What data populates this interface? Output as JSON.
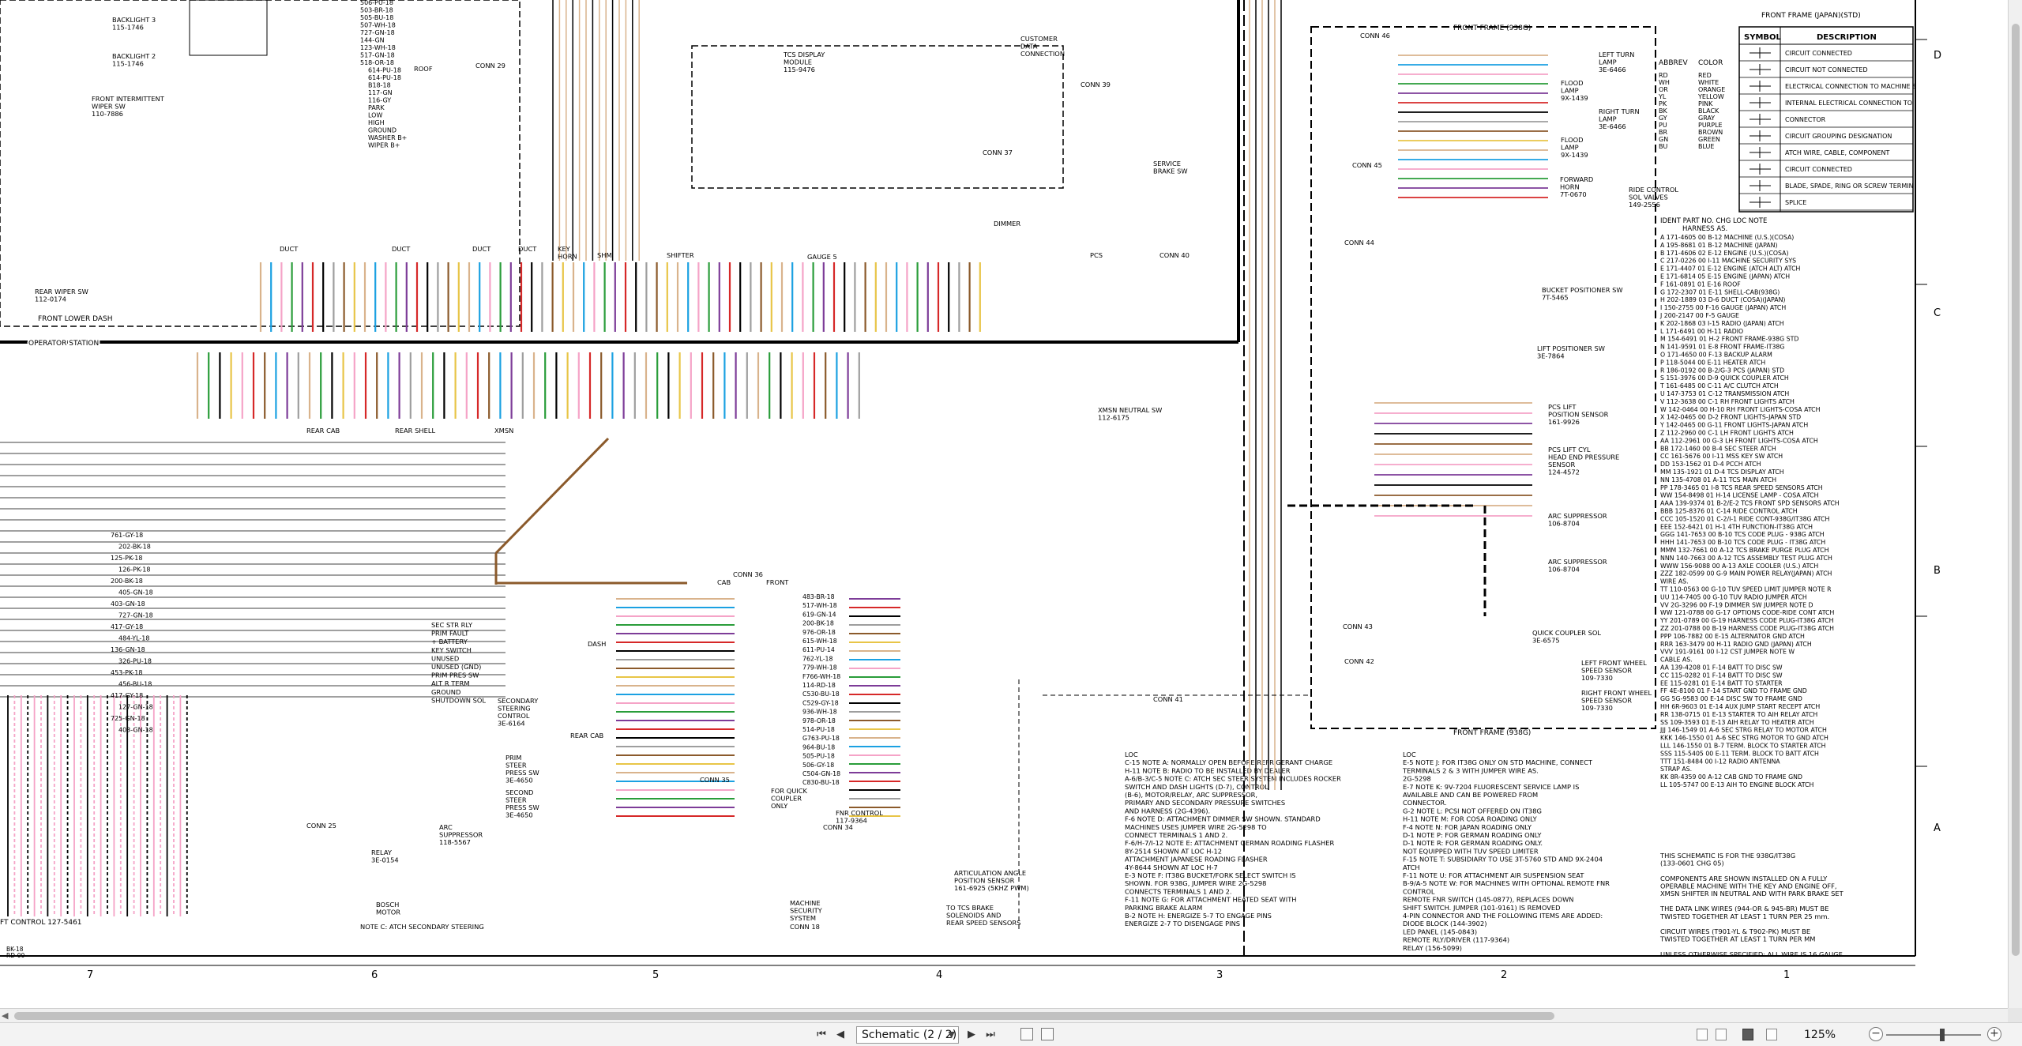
{
  "page_selector": {
    "value": "Schematic (2 / 2)"
  },
  "zoom": {
    "value": "125%"
  },
  "frame": {
    "front_frame_sto": "FRONT FRAME (JAPAN)(STD)",
    "front_frame_938g": "FRONT FRAME (938G)",
    "front_frame_938g_bottom": "FRONT FRAME (938G)",
    "operator_station": "OPERATOR STATION",
    "front_lower_dash": "FRONT LOWER DASH",
    "col_numbers": [
      "7",
      "6",
      "5",
      "4",
      "3",
      "2",
      "1"
    ],
    "row_letters": [
      "D",
      "C",
      "B",
      "A"
    ]
  },
  "symbol_table": {
    "headers": [
      "SYMBOL",
      "DESCRIPTION"
    ],
    "rows": [
      "CIRCUIT CONNECTED",
      "CIRCUIT NOT CONNECTED",
      "ELECTRICAL CONNECTION TO MACHINE STRUCTURE",
      "INTERNAL ELECTRICAL CONNECTION TO SURFACE OF COMPONENT",
      "CONNECTOR",
      "CIRCUIT GROUPING DESIGNATION",
      "ATCH WIRE, CABLE, COMPONENT",
      "CIRCUIT CONNECTED",
      "BLADE, SPADE, RING OR SCREW TERMINAL",
      "SPLICE"
    ]
  },
  "color_table": {
    "headers": [
      "ABBREV",
      "COLOR"
    ],
    "rows": [
      [
        "RD",
        "RED"
      ],
      [
        "WH",
        "WHITE"
      ],
      [
        "OR",
        "ORANGE"
      ],
      [
        "YL",
        "YELLOW"
      ],
      [
        "PK",
        "PINK"
      ],
      [
        "BK",
        "BLACK"
      ],
      [
        "GY",
        "GRAY"
      ],
      [
        "PU",
        "PURPLE"
      ],
      [
        "BR",
        "BROWN"
      ],
      [
        "GN",
        "GREEN"
      ],
      [
        "BU",
        "BLUE"
      ]
    ]
  },
  "harness_table": {
    "header": "IDENT  PART NO.  CHG LOC      NOTE",
    "subheader": "HARNESS AS.",
    "rows": [
      "A    171-4605  00  B-12  MACHINE (U.S.)(COSA)",
      "A    195-8681  01  B-12  MACHINE (JAPAN)",
      "B    171-4606  02  E-12  ENGINE (U.S.)(COSA)",
      "C    217-0226  00  I-11  MACHINE SECURITY SYS",
      "E    171-4407  01  E-12  ENGINE (ATCH ALT)         ATCH",
      "E    171-6814  05  E-15  ENGINE (JAPAN)            ATCH",
      "F    161-0891  01  E-16  ROOF",
      "G    172-2307  01  E-11  SHELL-CAB(938G)",
      "H    202-1889  03  D-6   DUCT (COSA)(JAPAN)",
      "I    150-2755  00  F-16  GAUGE (JAPAN)             ATCH",
      "J    200-2147  00  F-5   GAUGE",
      "K    202-1868  03  I-15  RADIO (JAPAN)             ATCH",
      "L    171-6491  00  H-11  RADIO",
      "M    154-6491  01  H-2   FRONT FRAME-938G          STD",
      "N    141-9591  01  E-8   FRONT FRAME-IT38G",
      "O    171-4650  00  F-13  BACKUP ALARM",
      "P    118-5044  00  E-11  HEATER                    ATCH",
      "R    186-0192  00  B-2/G-3  PCS (JAPAN)            STD",
      "S    151-3976  00  D-9   QUICK COUPLER             ATCH",
      "T    161-6485  00  C-11  A/C CLUTCH                ATCH",
      "U    147-3753  01  C-12  TRANSMISSION              ATCH",
      "V    112-3638  00  C-1   RH FRONT LIGHTS           ATCH",
      "W    142-0464  00  H-10  RH FRONT LIGHTS-COSA      ATCH",
      "X    142-0465  00  D-2   FRONT LIGHTS-JAPAN        STD",
      "Y    142-0465  00  G-11  FRONT LIGHTS-JAPAN        ATCH",
      "Z    112-2960  00  C-1   LH FRONT LIGHTS           ATCH",
      "AA   112-2961  00  G-3   LH FRONT LIGHTS-COSA      ATCH",
      "BB   172-1460  00  B-4   SEC STEER                 ATCH",
      "CC   161-5676  00  I-11  MSS KEY SW                ATCH",
      "DD   153-1562  01  D-4   PCCH                      ATCH",
      "MM   135-1921  01  D-4   TCS DISPLAY               ATCH",
      "NN   135-4708  01  A-11  TCS MAIN                  ATCH",
      "PP   178-3465  01  I-8   TCS REAR SPEED SENSORS    ATCH",
      "WW   154-8498  01  H-14  LICENSE LAMP - COSA       ATCH",
      "AAA  139-9374  01  B-2/E-2  TCS FRONT SPD SENSORS  ATCH",
      "BBB  125-8376  01  C-14  RIDE CONTROL              ATCH",
      "CCC  105-1520  01  C-2/I-1  RIDE CONT-938G/IT38G   ATCH",
      "EEE  152-6421  01  H-1   4TH FUNCTION-IT38G        ATCH",
      "GGG  141-7653  00  B-10  TCS CODE PLUG - 938G      ATCH",
      "HHH  141-7653  00  B-10  TCS CODE PLUG - IT38G     ATCH",
      "MMM  132-7661  00  A-12  TCS BRAKE PURGE PLUG      ATCH",
      "NNN  140-7663  00  A-12  TCS ASSEMBLY TEST PLUG    ATCH",
      "WWW  156-9088  00  A-13  AXLE COOLER (U.S.)        ATCH",
      "ZZZ  182-0599  00  G-9   MAIN POWER RELAY(JAPAN)   ATCH",
      "WIRE AS.",
      "TT   110-0563  00  G-10  TUV SPEED LIMIT JUMPER    NOTE R",
      "UU   114-7405  00  G-10  TUV RADIO JUMPER          ATCH",
      "VV   2G-3296   00  F-19  DIMMER SW JUMPER          NOTE D",
      "WW   121-0788  00  G-17  OPTIONS CODE-RIDE CONT    ATCH",
      "YY   201-0789  00  G-19  HARNESS CODE PLUG-IT38G   ATCH",
      "ZZ   201-0788  00  B-19  HARNESS CODE PLUG-IT38G   ATCH",
      "PPP  106-7882  00  E-15  ALTERNATOR GND            ATCH",
      "RRR  163-3479  00  H-11  RADIO GND (JAPAN)         ATCH",
      "VVV  191-9161  00  I-12  CST JUMPER                NOTE W",
      "CABLE AS.",
      "AA   139-4208  01  F-14  BATT TO DISC SW",
      "CC   115-0282  01  F-14  BATT TO DISC SW",
      "EE   115-0281  01  E-14  BATT TO STARTER",
      "FF   4E-8100   01  F-14  START GND TO FRAME GND",
      "GG   5G-9583   00  E-14  DISC SW TO FRAME GND",
      "HH   6R-9603   01  E-14  AUX JUMP START RECEPT     ATCH",
      "RR   138-0715  01  E-13  STARTER TO AIH RELAY      ATCH",
      "SS   109-3593  01  E-13  AIH RELAY TO HEATER       ATCH",
      "JJJ  146-1549  01  A-6   SEC STRG RELAY TO MOTOR   ATCH",
      "KKK  146-1550  01  A-6   SEC STRG MOTOR TO GND     ATCH",
      "LLL  146-1550  01  B-7   TERM. BLOCK TO STARTER    ATCH",
      "SSS  115-5405  00  E-11  TERM. BLOCK TO BATT       ATCH",
      "TTT  151-8484  00  I-12  RADIO ANTENNA",
      "STRAP AS.",
      "KK   8R-4359   00  A-12  CAB GND TO FRAME GND",
      "LL   105-5747  00  E-13  AIH TO ENGINE BLOCK       ATCH"
    ]
  },
  "notes_left": [
    "LOC",
    "C-15   NOTE A: NORMALLY OPEN BEFORE REFRIGERANT CHARGE",
    "H-11   NOTE B: RADIO TO BE INSTALLED BY DEALER",
    "A-6/B-3/C-5  NOTE C: ATCH SEC STEER SYSTEM INCLUDES ROCKER",
    "       SWITCH AND DASH LIGHTS (D-7), CONTROL",
    "       (B-6), MOTOR/RELAY, ARC SUPPRESSOR,",
    "       PRIMARY AND SECONDARY PRESSURE SWITCHES",
    "       AND HARNESS (2G-4396).",
    "F-6    NOTE D: ATTACHMENT DIMMER SW SHOWN. STANDARD",
    "       MACHINES USES JUMPER WIRE 2G-5298 TO",
    "       CONNECT TERMINALS 1 AND 2.",
    "F-6/H-7/I-12  NOTE E: ATTACHMENT GERMAN ROADING FLASHER",
    "       8Y-2514 SHOWN AT LOC H-12",
    "       ATTACHMENT JAPANESE ROADING FLASHER",
    "       4Y-8644 SHOWN AT LOC H-7",
    "E-3    NOTE F: IT38G BUCKET/FORK SELECT SWITCH IS",
    "       SHOWN. FOR 938G, JUMPER WIRE 2G-5298",
    "       CONNECTS TERMINALS 1 AND 2.",
    "F-11   NOTE G: FOR ATTACHMENT HEATED SEAT WITH",
    "       PARKING BRAKE ALARM",
    "B-2    NOTE H: ENERGIZE 5-7 TO ENGAGE PINS",
    "       ENERGIZE 2-7 TO DISENGAGE PINS"
  ],
  "notes_right": [
    "LOC",
    "E-5    NOTE J: FOR IT38G ONLY ON STD MACHINE, CONNECT",
    "       TERMINALS 2 & 3 WITH JUMPER WIRE AS.",
    "       2G-5298",
    "E-7    NOTE K: 9V-7204 FLUORESCENT SERVICE LAMP IS",
    "       AVAILABLE AND CAN BE POWERED FROM",
    "       CONNECTOR.",
    "G-2    NOTE L: PCSI NOT OFFERED ON IT38G",
    "H-11   NOTE M: FOR COSA ROADING ONLY",
    "F-4    NOTE N: FOR JAPAN ROADING ONLY",
    "D-1    NOTE P: FOR GERMAN ROADING ONLY",
    "D-1    NOTE R: FOR GERMAN ROADING ONLY.",
    "       NOT EQUIPPED WITH TUV SPEED LIMITER",
    "F-15   NOTE T: SUBSIDIARY TO USE 3T-5760 STD AND 9X-2404",
    "       ATCH",
    "F-11   NOTE U: FOR ATTACHMENT AIR SUSPENSION SEAT",
    "B-9/A-5  NOTE W: FOR MACHINES WITH OPTIONAL REMOTE FNR",
    "       CONTROL",
    "       REMOTE FNR SWITCH (145-0877), REPLACES DOWN",
    "       SHIFT SWITCH. JUMPER (101-9161) IS REMOVED",
    "       4-PIN CONNECTOR AND THE FOLLOWING ITEMS ARE ADDED:",
    "       DIODE BLOCK (144-3902)",
    "       LED PANEL (145-0843)",
    "       REMOTE RLY/DRIVER (117-9364)",
    "       RELAY (156-5099)"
  ],
  "footnotes": [
    "THIS SCHEMATIC IS FOR THE 938G/IT38G",
    "(133-0601 CHG 05)",
    "",
    "COMPONENTS ARE SHOWN INSTALLED ON A FULLY",
    "OPERABLE MACHINE WITH THE KEY AND ENGINE OFF,",
    "XMSN SHIFTER IN NEUTRAL AND WITH PARK BRAKE SET",
    "",
    "THE DATA LINK WIRES (944-OR & 945-BR) MUST BE",
    "TWISTED TOGETHER AT LEAST 1 TURN PER 25 mm.",
    "",
    "CIRCUIT WIRES (T901-YL & T902-PK) MUST BE",
    "TWISTED TOGETHER AT LEAST 1 TURN PER MM",
    "",
    "UNLESS OTHERWISE SPECIFIED: ALL WIRE IS 16 GAUGE"
  ],
  "components": [
    {
      "id": "backlight3",
      "label": "BACKLIGHT 3\n115-1746"
    },
    {
      "id": "backlight2",
      "label": "BACKLIGHT 2\n115-1746"
    },
    {
      "id": "front-int-wiper",
      "label": "FRONT INTERMITTENT\nWIPER SW\n110-7886"
    },
    {
      "id": "rear-wiper",
      "label": "REAR WIPER SW\n112-0174"
    },
    {
      "id": "tcs-display",
      "label": "TCS DISPLAY\nMODULE\n115-9476"
    },
    {
      "id": "customer-data",
      "label": "CUSTOMER\nDATA\nCONNECTION"
    },
    {
      "id": "service-brake",
      "label": "SERVICE\nBRAKE SW"
    },
    {
      "id": "forward-horn",
      "label": "FORWARD\nHORN\n7T-0670"
    },
    {
      "id": "ride-control",
      "label": "RIDE CONTROL\nSOL VALVES\n149-2556"
    },
    {
      "id": "flood-lamp-1",
      "label": "FLOOD\nLAMP\n9X-1439"
    },
    {
      "id": "flood-lamp-2",
      "label": "FLOOD\nLAMP\n9X-1439"
    },
    {
      "id": "left-turn",
      "label": "LEFT TURN\nLAMP\n3E-6466"
    },
    {
      "id": "right-turn",
      "label": "RIGHT TURN\nLAMP\n3E-6466"
    },
    {
      "id": "bucket-positioner",
      "label": "BUCKET POSITIONER SW\n7T-5465"
    },
    {
      "id": "lift-positioner",
      "label": "LIFT POSITIONER SW\n3E-7864"
    },
    {
      "id": "pcs-lift",
      "label": "PCS LIFT\nPOSITION SENSOR\n161-9926"
    },
    {
      "id": "pcs-lift-cyl",
      "label": "PCS LIFT CYL\nHEAD END PRESSURE\nSENSOR\n124-4572"
    },
    {
      "id": "arc-sup-1",
      "label": "ARC SUPPRESSOR\n106-8704"
    },
    {
      "id": "arc-sup-2",
      "label": "ARC SUPPRESSOR\n106-8704"
    },
    {
      "id": "quick-coupler-sol",
      "label": "QUICK COUPLER SOL\n3E-6575"
    },
    {
      "id": "left-front-wheel",
      "label": "LEFT FRONT WHEEL\nSPEED SENSOR\n109-7330"
    },
    {
      "id": "right-front-wheel",
      "label": "RIGHT FRONT WHEEL\nSPEED SENSOR\n109-7330"
    },
    {
      "id": "xmsn-neutral",
      "label": "XMSN NEUTRAL SW\n112-6175"
    },
    {
      "id": "sec-steering",
      "label": "SECONDARY\nSTEERING\nCONTROL\n3E-6164"
    },
    {
      "id": "prim-steer",
      "label": "PRIM\nSTEER\nPRESS SW\n3E-4650"
    },
    {
      "id": "second-steer",
      "label": "SECOND\nSTEER\nPRESS SW\n3E-4650"
    },
    {
      "id": "relay",
      "label": "RELAY\n3E-0154"
    },
    {
      "id": "arc-suppressor-s",
      "label": "ARC\nSUPPRESSOR\n118-5567"
    },
    {
      "id": "bosch-motor",
      "label": "BOSCH\nMOTOR"
    },
    {
      "id": "machine-security",
      "label": "MACHINE\nSECURITY\nSYSTEM"
    },
    {
      "id": "fnr-control",
      "label": "FNR CONTROL\n117-9364"
    },
    {
      "id": "quick-coupler-only",
      "label": "FOR QUICK\nCOUPLER\nONLY"
    },
    {
      "id": "articulation",
      "label": "ARTICULATION ANGLE\nPOSITION SENSOR\n161-6925 (5KHZ PWM)"
    },
    {
      "id": "tcs-brake",
      "label": "TO TCS BRAKE\nSOLENOIDS AND\nREAR SPEED SENSORS"
    },
    {
      "id": "note-c",
      "label": "NOTE C: ATCH SECONDARY STEERING"
    },
    {
      "id": "rear-shell",
      "label": "REAR SHELL"
    },
    {
      "id": "rear-cab",
      "label": "REAR CAB"
    },
    {
      "id": "xmsn",
      "label": "XMSN"
    },
    {
      "id": "shifter",
      "label": "SHIFTER"
    },
    {
      "id": "key-horn",
      "label": "KEY\nHORN"
    },
    {
      "id": "pcs",
      "label": "PCS"
    },
    {
      "id": "dimmer",
      "label": "DIMMER"
    },
    {
      "id": "gauge",
      "label": "GAUGE 5"
    },
    {
      "id": "conn29",
      "label": "CONN 29"
    },
    {
      "id": "conn36",
      "label": "CONN 36"
    },
    {
      "id": "conn39",
      "label": "CONN 39"
    },
    {
      "id": "conn40",
      "label": "CONN 40"
    },
    {
      "id": "conn41",
      "label": "CONN 41"
    },
    {
      "id": "conn42",
      "label": "CONN 42"
    },
    {
      "id": "conn43",
      "label": "CONN 43"
    },
    {
      "id": "conn44",
      "label": "CONN 44"
    },
    {
      "id": "conn45",
      "label": "CONN 45"
    },
    {
      "id": "conn46",
      "label": "CONN 46"
    },
    {
      "id": "conn34",
      "label": "CONN 34"
    },
    {
      "id": "conn35",
      "label": "CONN 35"
    },
    {
      "id": "conn37",
      "label": "CONN 37"
    },
    {
      "id": "conn18",
      "label": "CONN 18"
    },
    {
      "id": "conn25",
      "label": "CONN 25"
    }
  ],
  "wire_labels_left": [
    "506-PU-18",
    "503-BR-18",
    "505-BU-18",
    "507-WH-18",
    "727-GN-18",
    "144-GN",
    "123-WH-18",
    "517-GN-18",
    "518-OR-18",
    "614-PU-18",
    "614-PU-18",
    "B18-18",
    "117-GN",
    "116-GY",
    "PARK",
    "LOW",
    "HIGH",
    "GROUND",
    "WASHER B+",
    "WIPER B+"
  ],
  "wire_labels_lower": [
    "761-GY-18",
    "202-BK-18",
    "125-PK-18",
    "126-PK-18",
    "200-BK-18",
    "405-GN-18",
    "403-GN-18",
    "727-GN-18",
    "417-GY-18",
    "484-YL-18",
    "136-GN-18",
    "326-PU-18",
    "453-PK-18",
    "456-BU-18",
    "417-GY-18",
    "127-GN-18",
    "725-GN-18",
    "403-GN-18"
  ],
  "keyswitch_labels": [
    "SEC STR RLY",
    "PRIM FAULT",
    "+ BATTERY",
    "KEY SWITCH",
    "UNUSED",
    "UNUSED (GND)",
    "PRIM PRES SW",
    "ALT R TERM",
    "GROUND",
    "SHUTDOWN SOL"
  ],
  "conn_labels": [
    "CAB",
    "FRONT",
    "DASH",
    "REAR CAB",
    "ROOF",
    "DUCT",
    "DUCT",
    "DUCT",
    "DUCT",
    "SHM"
  ],
  "front_conn_wires": [
    "483-BR-18",
    "517-WH-18",
    "619-GN-14",
    "200-BK-18",
    "976-OR-18",
    "615-WH-18",
    "611-PU-14",
    "762-YL-18",
    "779-WH-18",
    "F766-WH-18",
    "114-RD-18",
    "C530-BU-18",
    "C529-GY-18",
    "936-WH-18",
    "978-OR-18",
    "514-PU-18",
    "G763-PU-18",
    "964-BU-18",
    "505-PU-18",
    "506-GY-18",
    "C504-GN-18",
    "C830-BU-18"
  ],
  "footer_lower_left": "FT CONTROL 127-5461",
  "conn_label_bottom": [
    "BK-18",
    "RD-00"
  ]
}
